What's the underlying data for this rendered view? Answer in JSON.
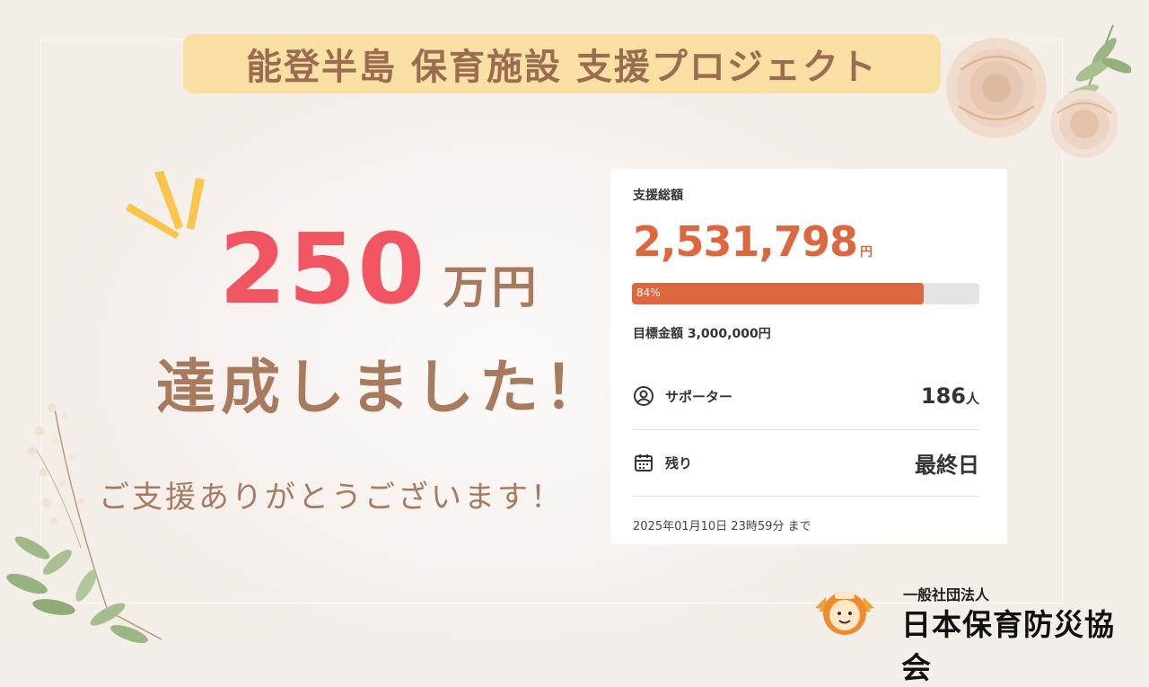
{
  "header": {
    "title": "能登半島 保育施設 支援プロジェクト"
  },
  "announcement": {
    "amount": "250",
    "unit": "万円",
    "achieved": "達成しました！",
    "thanks": "ご支援ありがとうございます！"
  },
  "card": {
    "total_label": "支援総額",
    "total_amount": "2,531,798",
    "total_unit": "円",
    "progress_text": "84%",
    "progress_value": 0.84,
    "target": "目標金額 3,000,000円",
    "supporters_label": "サポーター",
    "supporters_count": "186",
    "supporters_unit": "人",
    "remaining_label": "残り",
    "remaining_value": "最終日",
    "deadline": "2025年01月10日 23時59分 まで"
  },
  "org": {
    "type": "一般社団法人",
    "name": "日本保育防災協会"
  },
  "colors": {
    "accent": "#dd6840",
    "headline": "#f25562",
    "brown": "#a87b5f",
    "title_bg": "#fbe0a3"
  }
}
